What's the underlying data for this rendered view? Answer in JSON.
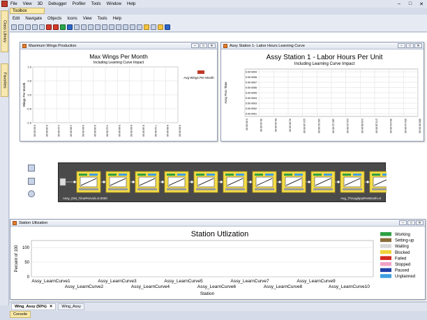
{
  "menubar": {
    "items": [
      "File",
      "View",
      "3D",
      "Debugger",
      "Profiler",
      "Tools",
      "Window",
      "Help"
    ],
    "window_controls": [
      "–",
      "□",
      "✕"
    ]
  },
  "toolbox_tab": "Toolbox",
  "sidebar": {
    "tabs": [
      "Class Library",
      "Favorites"
    ]
  },
  "menubar2": {
    "items": [
      "Edit",
      "Navigate",
      "Objects",
      "Icons",
      "View",
      "Tools",
      "Help"
    ]
  },
  "toolbar": {
    "icons": [
      "new-icon",
      "open-icon",
      "save-icon",
      "print-icon",
      "reset-icon",
      "stop-icon",
      "run-icon",
      "step-icon",
      "clock-icon",
      "copy-icon",
      "brush-icon",
      "zoom-in-icon",
      "zoom-out-icon",
      "select-icon",
      "grid-icon",
      "pencil-icon",
      "connect-icon",
      "arrow-icon",
      "link-icon",
      "palette-icon",
      "snap-icon",
      "tag-icon",
      "help-icon"
    ]
  },
  "panel1": {
    "title": "Maximum Wings Production",
    "chart_data": {
      "type": "line",
      "title": "Max Wings Per Month",
      "subtitle": "Including Learning Curve Impact",
      "ylabel": "Wings Per Month",
      "ylim": [
        -1.0,
        1.0
      ],
      "yticks": [
        "1.0",
        "0.5",
        "0.0",
        "-0.5",
        "-1.0"
      ],
      "xticks": [
        "0:00:00:00",
        "0:18:00:00",
        "1:12:00:00",
        "2:06:00:00",
        "3:00:00:00",
        "3:18:00:00",
        "4:12:00:00",
        "5:06:00:00",
        "6:00:00:00",
        "6:18:00:00",
        "7:12:00:00",
        "8:06:00:00",
        "9:00:00:00"
      ],
      "series": [
        {
          "name": "Avg Wings Per Month",
          "color": "#c0392b",
          "values": []
        }
      ],
      "legend": "right"
    },
    "controls": [
      "–",
      "□",
      "✕"
    ]
  },
  "panel2": {
    "title": "Assy Station 1- Labor Hours Learning Curve",
    "chart_data": {
      "type": "line",
      "title": "Assy Station 1 - Labor Hours Per Unit",
      "subtitle": "Including Learning Curve Impact",
      "ylabel": "Assy Proc Time",
      "yticks": [
        "0.00 0009",
        "0.00 0008",
        "0.00 0007",
        "0.00 0006",
        "0.00 0005",
        "0.00 0004",
        "0.00 0003",
        "0.00 0002",
        "0.00 0001"
      ],
      "xticks": [
        "0:00:00:00",
        "30:10:00:00",
        "60:20:00:00",
        "91:06:00:00",
        "121:16:00:00",
        "152:02:00:00",
        "182:12:00:00",
        "212:22:00:00",
        "243:08:00:00",
        "273:18:00:00",
        "304:04:00:00",
        "334:14:00:00",
        "365:00:00:00"
      ],
      "series": []
    },
    "controls": [
      "–",
      "□",
      "✕"
    ]
  },
  "model": {
    "left_label": "Assy_Dist_TimePerUnit=0.0000",
    "right_label": "Avg_ThroughputPerMonth=0",
    "stations": 11
  },
  "panel3": {
    "title": "Station Utlization",
    "chart_data": {
      "type": "bar",
      "title": "Station Utlization",
      "xlabel": "Station",
      "ylabel": "Percent of 100",
      "ylim": [
        0,
        100
      ],
      "yticks": [
        "100",
        "50",
        "0"
      ],
      "categories": [
        "Assy_LearnCurve1",
        "Assy_LearnCurve2",
        "Assy_LearnCurve3",
        "Assy_LearnCurve4",
        "Assy_LearnCurve5",
        "Assy_LearnCurve6",
        "Assy_LearnCurve7",
        "Assy_LearnCurve8",
        "Assy_LearnCurve9",
        "Assy_LearnCurve10"
      ],
      "series": [
        {
          "name": "Working",
          "color": "#2ea043",
          "values": []
        },
        {
          "name": "Setting-up",
          "color": "#8a6d3b",
          "values": []
        },
        {
          "name": "Waiting",
          "color": "#d8d8d8",
          "values": []
        },
        {
          "name": "Blocked",
          "color": "#f0d23a",
          "values": []
        },
        {
          "name": "Failed",
          "color": "#d62a1e",
          "values": []
        },
        {
          "name": "Stopped",
          "color": "#f2a1c5",
          "values": []
        },
        {
          "name": "Paused",
          "color": "#1f3fa8",
          "values": []
        },
        {
          "name": "Unplanned",
          "color": "#3c9ee0",
          "values": []
        }
      ],
      "legend": "right"
    },
    "controls": [
      "–",
      "□",
      "✕"
    ]
  },
  "status": {
    "tabs": [
      {
        "label": "Wing_Assy (50%)",
        "active": true,
        "close": "✕"
      },
      {
        "label": "Wing_Assy",
        "active": false
      }
    ],
    "console": "Console"
  }
}
